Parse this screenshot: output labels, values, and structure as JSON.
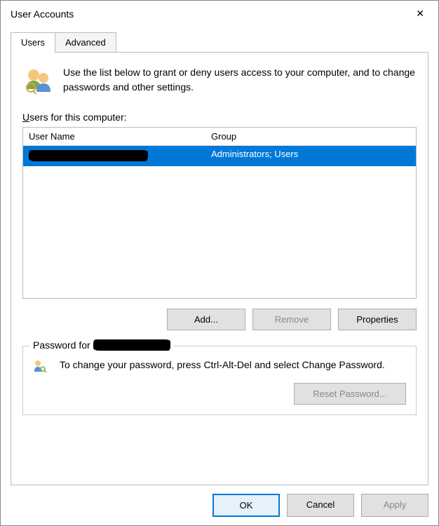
{
  "title": "User Accounts",
  "tabs": {
    "users": "Users",
    "advanced": "Advanced"
  },
  "intro": "Use the list below to grant or deny users access to your computer, and to change passwords and other settings.",
  "users_label_pre": "U",
  "users_label_post": "sers for this computer:",
  "columns": {
    "username": "User Name",
    "group": "Group"
  },
  "rows": [
    {
      "username": "[redacted]",
      "group": "Administrators; Users"
    }
  ],
  "buttons": {
    "add": "Add...",
    "remove": "Remove",
    "properties": "Properties"
  },
  "password_group_prefix": "Password for",
  "password_text": "To change your password, press Ctrl-Alt-Del and select Change Password.",
  "reset_password": "Reset Password...",
  "footer": {
    "ok": "OK",
    "cancel": "Cancel",
    "apply": "Apply"
  }
}
